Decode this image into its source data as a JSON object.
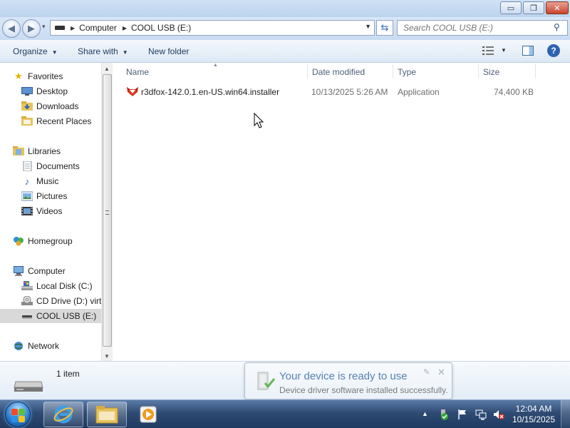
{
  "window": {
    "minimize_glyph": "▭",
    "maximize_glyph": "❐",
    "close_glyph": "✕"
  },
  "address_bar": {
    "breadcrumbs": [
      "Computer",
      "COOL USB (E:)"
    ],
    "search_placeholder": "Search COOL USB (E:)"
  },
  "toolbar": {
    "organize_label": "Organize",
    "share_label": "Share with",
    "new_folder_label": "New folder"
  },
  "nav": {
    "favorites": {
      "label": "Favorites",
      "items": [
        "Desktop",
        "Downloads",
        "Recent Places"
      ]
    },
    "libraries": {
      "label": "Libraries",
      "items": [
        "Documents",
        "Music",
        "Pictures",
        "Videos"
      ]
    },
    "homegroup": {
      "label": "Homegroup"
    },
    "computer": {
      "label": "Computer",
      "items": [
        "Local Disk (C:)",
        "CD Drive (D:) virt",
        "COOL USB (E:)"
      ],
      "selected": "COOL USB (E:)"
    },
    "network": {
      "label": "Network"
    }
  },
  "columns": {
    "name": "Name",
    "date": "Date modified",
    "type": "Type",
    "size": "Size"
  },
  "files": [
    {
      "name": "r3dfox-142.0.1.en-US.win64.installer",
      "date": "10/13/2025 5:26 AM",
      "type": "Application",
      "size": "74,400 KB"
    }
  ],
  "details": {
    "count": "1 item"
  },
  "notification": {
    "title": "Your device is ready to use",
    "body": "Device driver software installed successfully."
  },
  "taskbar": {
    "time": "12:04 AM",
    "date": "10/15/2025"
  },
  "colors": {
    "accent": "#2e63b0",
    "selection": "#d9d9d9",
    "taskbar": "#2e4b74"
  }
}
